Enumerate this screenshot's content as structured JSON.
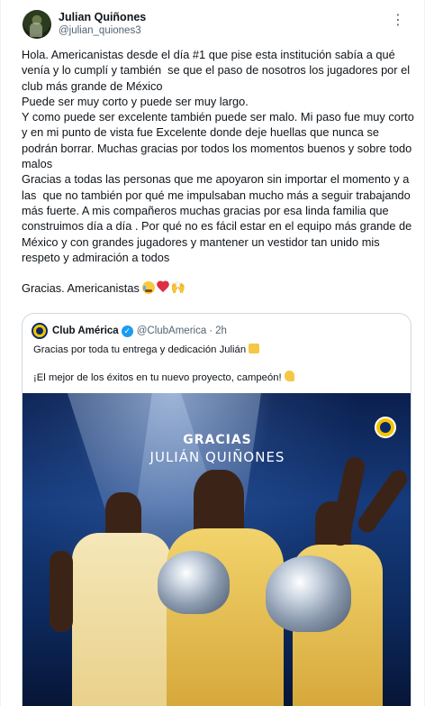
{
  "tweet": {
    "author": {
      "display_name": "Julian Quiñones",
      "handle": "@julian_quiones3"
    },
    "more_icon": "more-icon",
    "paragraphs": [
      "Hola. Americanistas desde el día #1 que pise esta institución sabía a qué venía y lo cumplí y también  se que el paso de nosotros los jugadores por el club más grande de México",
      "Puede ser muy corto y puede ser muy largo.",
      "Y como puede ser excelente también puede ser malo. Mi paso fue muy corto y en mi punto de vista fue Excelente donde deje huellas que nunca se podrán borrar. Muchas gracias por todos los momentos buenos y sobre todo malos",
      "Gracias a todas las personas que me apoyaron sin importar el momento y a las  que no también por qué me impulsaban mucho más a seguir trabajando más fuerte. A mis compañeros muchas gracias por esa linda familia que construimos día a día . Por qué no es fácil estar en el equipo más grande de México y con grandes jugadores y mantener un vestidor tan unido mis respeto y admiración a todos"
    ],
    "closing": "Gracias. Americanistas",
    "closing_emojis": [
      "crying-face-emoji",
      "red-heart-emoji",
      "raising-hands-emoji"
    ]
  },
  "quote": {
    "author": {
      "display_name": "Club América",
      "handle": "@ClubAmerica",
      "separator": "·",
      "time": "2h",
      "verified": true
    },
    "lines": [
      "Gracias por toda tu entrega y dedicación Julián",
      "¡El mejor de los éxitos en tu nuevo proyecto, campeón!"
    ],
    "image": {
      "title_line1": "GRACIAS",
      "title_line2": "JULIÁN QUIÑONES"
    }
  },
  "colors": {
    "text": "#0f1419",
    "secondary": "#536471",
    "border": "#cfd9de",
    "verified": "#1d9bf0",
    "club_yellow": "#f5c400",
    "club_navy": "#0b2a6b"
  }
}
